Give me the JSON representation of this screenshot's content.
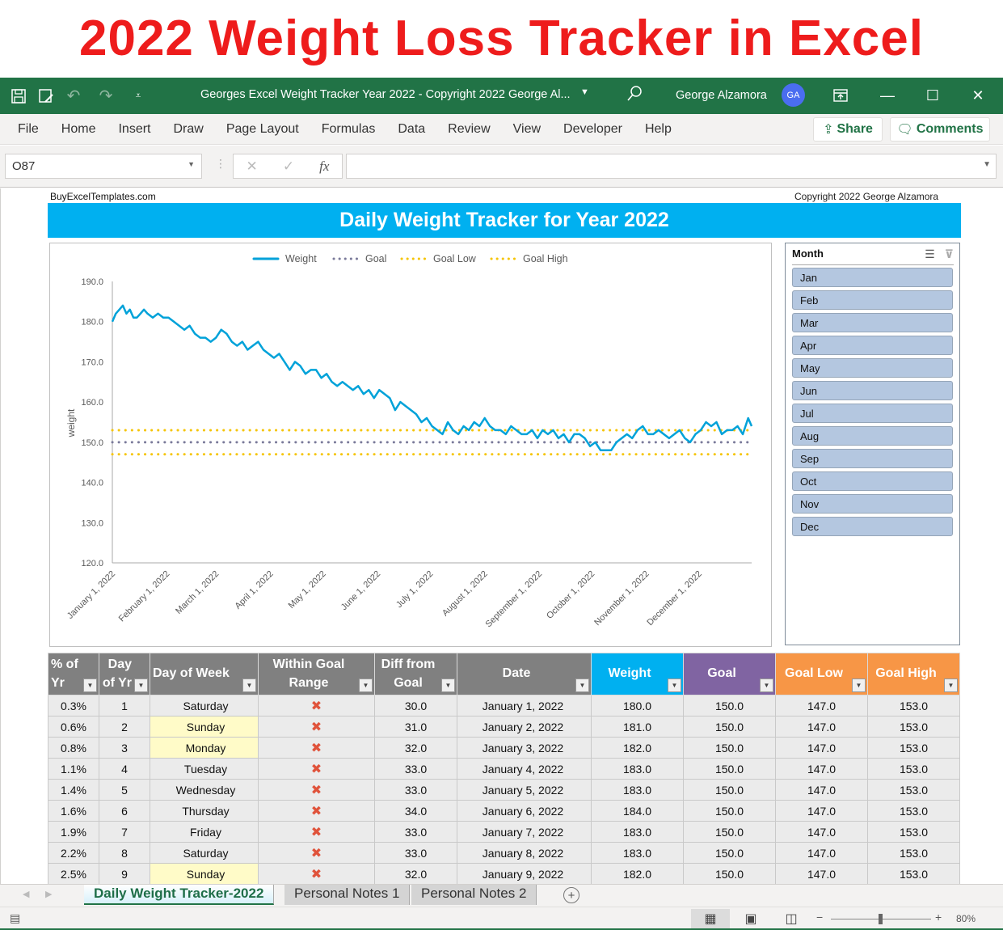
{
  "banner": {
    "title": "2022 Weight Loss Tracker in Excel"
  },
  "titlebar": {
    "doc_title": "Georges Excel Weight Tracker Year 2022 - Copyright 2022 George Al...",
    "user_name": "George Alzamora",
    "avatar_initials": "GA"
  },
  "ribbon": {
    "tabs": [
      "File",
      "Home",
      "Insert",
      "Draw",
      "Page Layout",
      "Formulas",
      "Data",
      "Review",
      "View",
      "Developer",
      "Help"
    ],
    "share_label": "Share",
    "comments_label": "Comments"
  },
  "formula_bar": {
    "name_box": "O87",
    "formula": ""
  },
  "sheet": {
    "site": "BuyExcelTemplates.com",
    "copyright": "Copyright 2022  George Alzamora",
    "header": "Daily Weight Tracker for Year 2022"
  },
  "slicer": {
    "title": "Month",
    "items": [
      "Jan",
      "Feb",
      "Mar",
      "Apr",
      "May",
      "Jun",
      "Jul",
      "Aug",
      "Sep",
      "Oct",
      "Nov",
      "Dec"
    ]
  },
  "colors": {
    "weight": "#00a2d9",
    "goal": "#7a7a9a",
    "goal_band": "#f5c400",
    "header_gray": "#808080",
    "header_weight": "#00b0f0",
    "header_goal": "#8064a2",
    "header_band": "#f79646"
  },
  "chart_data": {
    "type": "line",
    "title": "",
    "xlabel": "",
    "ylabel": "weight",
    "ylim": [
      120,
      190
    ],
    "yticks": [
      "190.0",
      "180.0",
      "170.0",
      "160.0",
      "150.0",
      "140.0",
      "130.0",
      "120.0"
    ],
    "ytick_values": [
      190,
      180,
      170,
      160,
      150,
      140,
      130,
      120
    ],
    "xticks": [
      "January 1, 2022",
      "February 1, 2022",
      "March 1, 2022",
      "April 1, 2022",
      "May 1, 2022",
      "June 1, 2022",
      "July 1, 2022",
      "August 1, 2022",
      "September 1, 2022",
      "October 1, 2022",
      "November 1, 2022",
      "December 1, 2022"
    ],
    "xtick_days": [
      1,
      32,
      60,
      91,
      121,
      152,
      182,
      213,
      244,
      274,
      305,
      335
    ],
    "x_range_days": [
      1,
      365
    ],
    "legend": [
      "Weight",
      "Goal",
      "Goal Low",
      "Goal High"
    ],
    "legend_position": "top",
    "series": [
      {
        "name": "Weight",
        "style": "solid",
        "x_days": [
          1,
          3,
          5,
          7,
          9,
          11,
          13,
          15,
          17,
          19,
          21,
          24,
          27,
          30,
          33,
          36,
          39,
          42,
          45,
          48,
          51,
          54,
          57,
          60,
          63,
          66,
          69,
          72,
          75,
          78,
          81,
          84,
          87,
          90,
          93,
          96,
          99,
          102,
          105,
          108,
          111,
          114,
          117,
          120,
          123,
          126,
          129,
          132,
          135,
          138,
          141,
          144,
          147,
          150,
          153,
          156,
          159,
          162,
          165,
          168,
          171,
          174,
          177,
          180,
          183,
          186,
          189,
          192,
          195,
          198,
          201,
          204,
          207,
          210,
          213,
          216,
          219,
          222,
          225,
          228,
          231,
          234,
          237,
          240,
          243,
          246,
          249,
          252,
          255,
          258,
          261,
          264,
          267,
          270,
          273,
          276,
          279,
          282,
          285,
          288,
          291,
          294,
          297,
          300,
          303,
          306,
          309,
          312,
          315,
          318,
          321,
          324,
          327,
          330,
          333,
          336,
          339,
          342,
          345,
          348,
          351,
          354,
          357,
          360,
          363,
          365
        ],
        "values": [
          180,
          182,
          183,
          184,
          182,
          183,
          181,
          181,
          182,
          183,
          182,
          181,
          182,
          181,
          181,
          180,
          179,
          178,
          179,
          177,
          176,
          176,
          175,
          176,
          178,
          177,
          175,
          174,
          175,
          173,
          174,
          175,
          173,
          172,
          171,
          172,
          170,
          168,
          170,
          169,
          167,
          168,
          168,
          166,
          167,
          165,
          164,
          165,
          164,
          163,
          164,
          162,
          163,
          161,
          163,
          162,
          161,
          158,
          160,
          159,
          158,
          157,
          155,
          156,
          154,
          153,
          152,
          155,
          153,
          152,
          154,
          153,
          155,
          154,
          156,
          154,
          153,
          153,
          152,
          154,
          153,
          152,
          152,
          153,
          151,
          153,
          152,
          153,
          151,
          152,
          150,
          152,
          152,
          151,
          149,
          150,
          148,
          148,
          148,
          150,
          151,
          152,
          151,
          153,
          154,
          152,
          152,
          153,
          152,
          151,
          152,
          153,
          151,
          150,
          152,
          153,
          155,
          154,
          155,
          152,
          153,
          153,
          154,
          152,
          156,
          154
        ]
      },
      {
        "name": "Goal",
        "style": "dotted",
        "constant": 150
      },
      {
        "name": "Goal Low",
        "style": "dotted",
        "constant": 147
      },
      {
        "name": "Goal High",
        "style": "dotted",
        "constant": 153
      }
    ]
  },
  "table": {
    "columns": [
      "% of Yr",
      "Day of Yr",
      "Day of Week",
      "Within Goal Range",
      "Diff from Goal",
      "Date",
      "Weight",
      "Goal",
      "Goal Low",
      "Goal High"
    ],
    "rows": [
      {
        "pct": "0.3%",
        "day": "1",
        "dow": "Saturday",
        "weekend": false,
        "within": "x",
        "diff": "30.0",
        "date": "January 1, 2022",
        "weight": "180.0",
        "goal": "150.0",
        "low": "147.0",
        "high": "153.0"
      },
      {
        "pct": "0.6%",
        "day": "2",
        "dow": "Sunday",
        "weekend": true,
        "within": "x",
        "diff": "31.0",
        "date": "January 2, 2022",
        "weight": "181.0",
        "goal": "150.0",
        "low": "147.0",
        "high": "153.0"
      },
      {
        "pct": "0.8%",
        "day": "3",
        "dow": "Monday",
        "weekend": true,
        "within": "x",
        "diff": "32.0",
        "date": "January 3, 2022",
        "weight": "182.0",
        "goal": "150.0",
        "low": "147.0",
        "high": "153.0"
      },
      {
        "pct": "1.1%",
        "day": "4",
        "dow": "Tuesday",
        "weekend": false,
        "within": "x",
        "diff": "33.0",
        "date": "January 4, 2022",
        "weight": "183.0",
        "goal": "150.0",
        "low": "147.0",
        "high": "153.0"
      },
      {
        "pct": "1.4%",
        "day": "5",
        "dow": "Wednesday",
        "weekend": false,
        "within": "x",
        "diff": "33.0",
        "date": "January 5, 2022",
        "weight": "183.0",
        "goal": "150.0",
        "low": "147.0",
        "high": "153.0"
      },
      {
        "pct": "1.6%",
        "day": "6",
        "dow": "Thursday",
        "weekend": false,
        "within": "x",
        "diff": "34.0",
        "date": "January 6, 2022",
        "weight": "184.0",
        "goal": "150.0",
        "low": "147.0",
        "high": "153.0"
      },
      {
        "pct": "1.9%",
        "day": "7",
        "dow": "Friday",
        "weekend": false,
        "within": "x",
        "diff": "33.0",
        "date": "January 7, 2022",
        "weight": "183.0",
        "goal": "150.0",
        "low": "147.0",
        "high": "153.0"
      },
      {
        "pct": "2.2%",
        "day": "8",
        "dow": "Saturday",
        "weekend": false,
        "within": "x",
        "diff": "33.0",
        "date": "January 8, 2022",
        "weight": "183.0",
        "goal": "150.0",
        "low": "147.0",
        "high": "153.0"
      },
      {
        "pct": "2.5%",
        "day": "9",
        "dow": "Sunday",
        "weekend": true,
        "within": "x",
        "diff": "32.0",
        "date": "January 9, 2022",
        "weight": "182.0",
        "goal": "150.0",
        "low": "147.0",
        "high": "153.0"
      }
    ]
  },
  "sheet_tabs": [
    {
      "label": "Daily Weight Tracker-2022",
      "active": true
    },
    {
      "label": "Personal Notes 1",
      "active": false
    },
    {
      "label": "Personal Notes 2",
      "active": false
    }
  ],
  "status": {
    "zoom": "80%",
    "zoom_fraction": 0.5
  }
}
